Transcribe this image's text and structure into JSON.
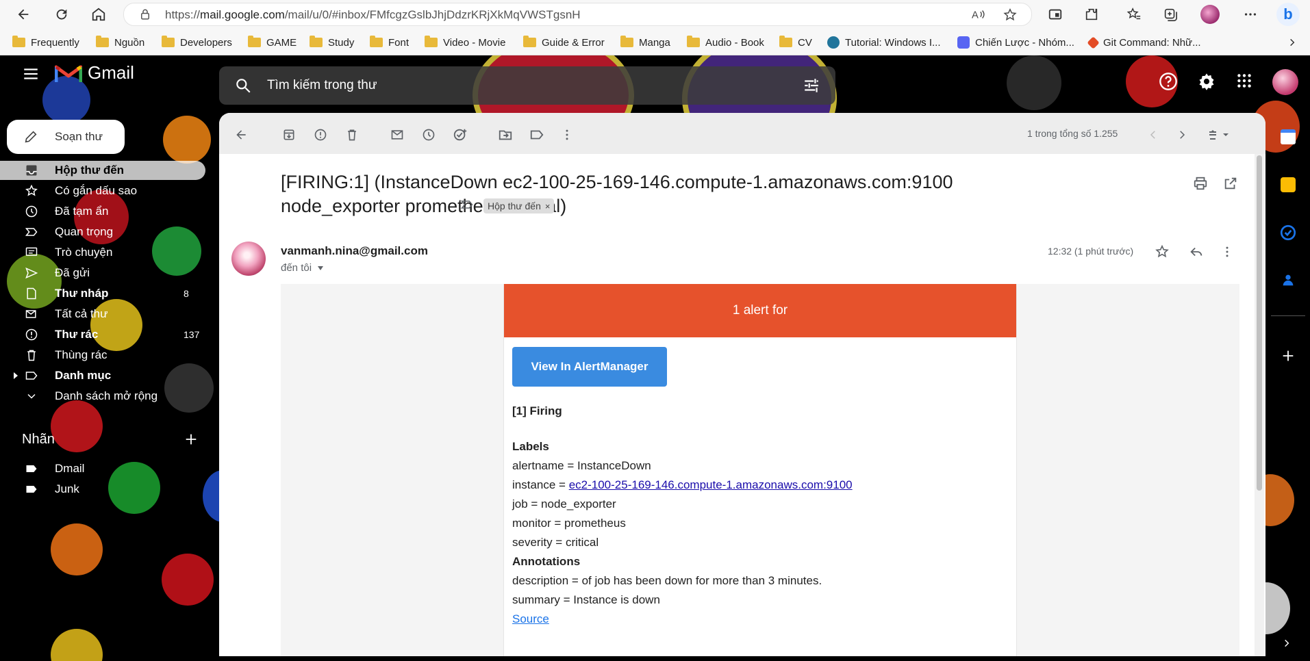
{
  "browser": {
    "url_prefix": "https://",
    "url_host": "mail.google.com",
    "url_path": "/mail/u/0/#inbox/FMfcgzGslbJhjDdzrKRjXkMqVWSTgsnH",
    "bookmarks": [
      {
        "label": "Frequently",
        "type": "folder"
      },
      {
        "label": "Nguồn",
        "type": "folder"
      },
      {
        "label": "Developers",
        "type": "folder"
      },
      {
        "label": "GAME",
        "type": "folder"
      },
      {
        "label": "Study",
        "type": "folder"
      },
      {
        "label": "Font",
        "type": "folder"
      },
      {
        "label": "Video - Movie",
        "type": "folder"
      },
      {
        "label": "Guide & Error",
        "type": "folder"
      },
      {
        "label": "Manga",
        "type": "folder"
      },
      {
        "label": "Audio - Book",
        "type": "folder"
      },
      {
        "label": "CV",
        "type": "folder"
      },
      {
        "label": "Tutorial: Windows I...",
        "type": "wordpress"
      },
      {
        "label": "Chiến Lược - Nhóm...",
        "type": "discord"
      },
      {
        "label": "Git Command: Nhữ...",
        "type": "site"
      }
    ]
  },
  "gmail": {
    "logo": "Gmail",
    "search_placeholder": "Tìm kiếm trong thư",
    "compose_label": "Soạn thư",
    "sidebar": [
      {
        "label": "Hộp thư đến",
        "icon": "inbox-icon",
        "count": "",
        "bold": true,
        "active": true
      },
      {
        "label": "Có gắn dấu sao",
        "icon": "star-icon",
        "count": "",
        "bold": false
      },
      {
        "label": "Đã tạm ẩn",
        "icon": "clock-icon",
        "count": "",
        "bold": false
      },
      {
        "label": "Quan trọng",
        "icon": "important-icon",
        "count": "",
        "bold": false
      },
      {
        "label": "Trò chuyện",
        "icon": "chat-icon",
        "count": "",
        "bold": false
      },
      {
        "label": "Đã gửi",
        "icon": "send-icon",
        "count": "",
        "bold": false
      },
      {
        "label": "Thư nháp",
        "icon": "draft-icon",
        "count": "8",
        "bold": true
      },
      {
        "label": "Tất cả thư",
        "icon": "all-mail-icon",
        "count": "",
        "bold": false
      },
      {
        "label": "Thư rác",
        "icon": "spam-icon",
        "count": "137",
        "bold": true
      },
      {
        "label": "Thùng rác",
        "icon": "trash-icon",
        "count": "",
        "bold": false
      },
      {
        "label": "Danh mục",
        "icon": "label-icon",
        "count": "",
        "bold": true
      },
      {
        "label": "Danh sách mở rộng",
        "icon": "chevron-down-icon",
        "count": "",
        "bold": false
      }
    ],
    "labels_heading": "Nhãn",
    "labels": [
      {
        "label": "Dmail"
      },
      {
        "label": "Junk"
      }
    ],
    "pagination": "1 trong tổng số 1.255"
  },
  "email": {
    "subject": "[FIRING:1] (InstanceDown ec2-100-25-169-146.compute-1.amazonaws.com:9100 node_exporter prometheus critical)",
    "tag": "Hộp thư đến",
    "sender": "vanmanh.nina@gmail.com",
    "to": "đến tôi",
    "time": "12:32 (1 phút trước)",
    "alert_header": "1 alert for",
    "button": "View In AlertManager",
    "firing": "[1] Firing",
    "labels_title": "Labels",
    "lines": {
      "alertname": "alertname = InstanceDown",
      "instance_prefix": "instance = ",
      "instance_link": "ec2-100-25-169-146.compute-1.amazonaws.com:9100",
      "job": "job = node_exporter",
      "monitor": "monitor = prometheus",
      "severity": "severity = critical"
    },
    "annotations_title": "Annotations",
    "description": "description = of job has been down for more than 3 minutes.",
    "summary": "summary = Instance is down",
    "source": "Source"
  },
  "colors": {
    "alert_orange": "#e6522c",
    "button_blue": "#3a8be0",
    "link_blue": "#1a0dab"
  }
}
